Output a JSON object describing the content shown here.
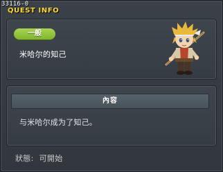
{
  "quest_id": "33116-0",
  "window_title": "QUEST INFO",
  "category": "一般",
  "quest_name": "米哈尔的知己",
  "content_header": "內容",
  "content_text": "与米哈尔成为了知己。",
  "status": {
    "label": "狀態:",
    "value": "可開始"
  },
  "npc_icon": "npc-mihile-portrait-icon",
  "colors": {
    "title": "#ffd82a",
    "category_badge": "#8fc23b",
    "panel": "#3a4047"
  }
}
